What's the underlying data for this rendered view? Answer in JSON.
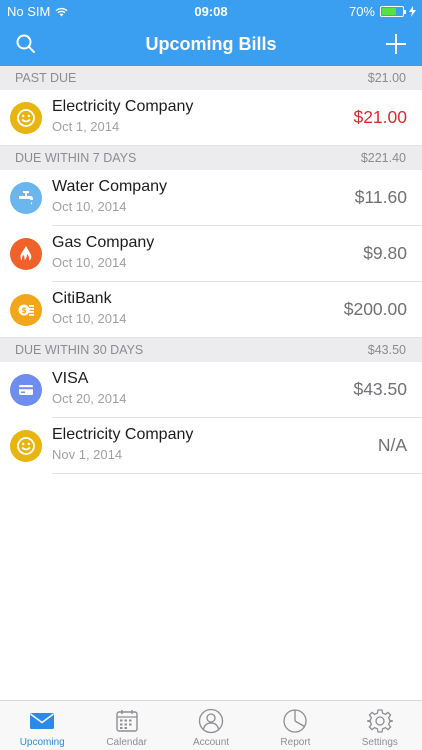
{
  "status": {
    "carrier": "No SIM",
    "time": "09:08",
    "battery": "70%",
    "battery_level": 0.7
  },
  "nav": {
    "title": "Upcoming Bills"
  },
  "sections": [
    {
      "title": "PAST DUE",
      "total": "$21.00"
    },
    {
      "title": "DUE WITHIN 7 DAYS",
      "total": "$221.40"
    },
    {
      "title": "DUE WITHIN 30 DAYS",
      "total": "$43.50"
    }
  ],
  "bills": [
    {
      "name": "Electricity Company",
      "date": "Oct 1, 2014",
      "amount": "$21.00",
      "icon": "smiley-icon",
      "color": "#e8b40e"
    },
    {
      "name": "Water Company",
      "date": "Oct 10, 2014",
      "amount": "$11.60",
      "icon": "faucet-icon",
      "color": "#6cb6ee"
    },
    {
      "name": "Gas Company",
      "date": "Oct 10, 2014",
      "amount": "$9.80",
      "icon": "flame-icon",
      "color": "#f0622a"
    },
    {
      "name": "CitiBank",
      "date": "Oct 10, 2014",
      "amount": "$200.00",
      "icon": "coins-icon",
      "color": "#f2a71b"
    },
    {
      "name": "VISA",
      "date": "Oct 20, 2014",
      "amount": "$43.50",
      "icon": "credit-card-icon",
      "color": "#6f8cf0"
    },
    {
      "name": "Electricity Company",
      "date": "Nov 1, 2014",
      "amount": "N/A",
      "icon": "smiley-icon",
      "color": "#e8b40e"
    }
  ],
  "colors": {
    "accent": "#3a9ff0",
    "overdue": "#d92c2c"
  },
  "tabs": [
    {
      "label": "Upcoming",
      "icon": "envelope-icon"
    },
    {
      "label": "Calendar",
      "icon": "calendar-icon"
    },
    {
      "label": "Account",
      "icon": "person-icon"
    },
    {
      "label": "Report",
      "icon": "pie-chart-icon"
    },
    {
      "label": "Settings",
      "icon": "gear-icon"
    }
  ]
}
